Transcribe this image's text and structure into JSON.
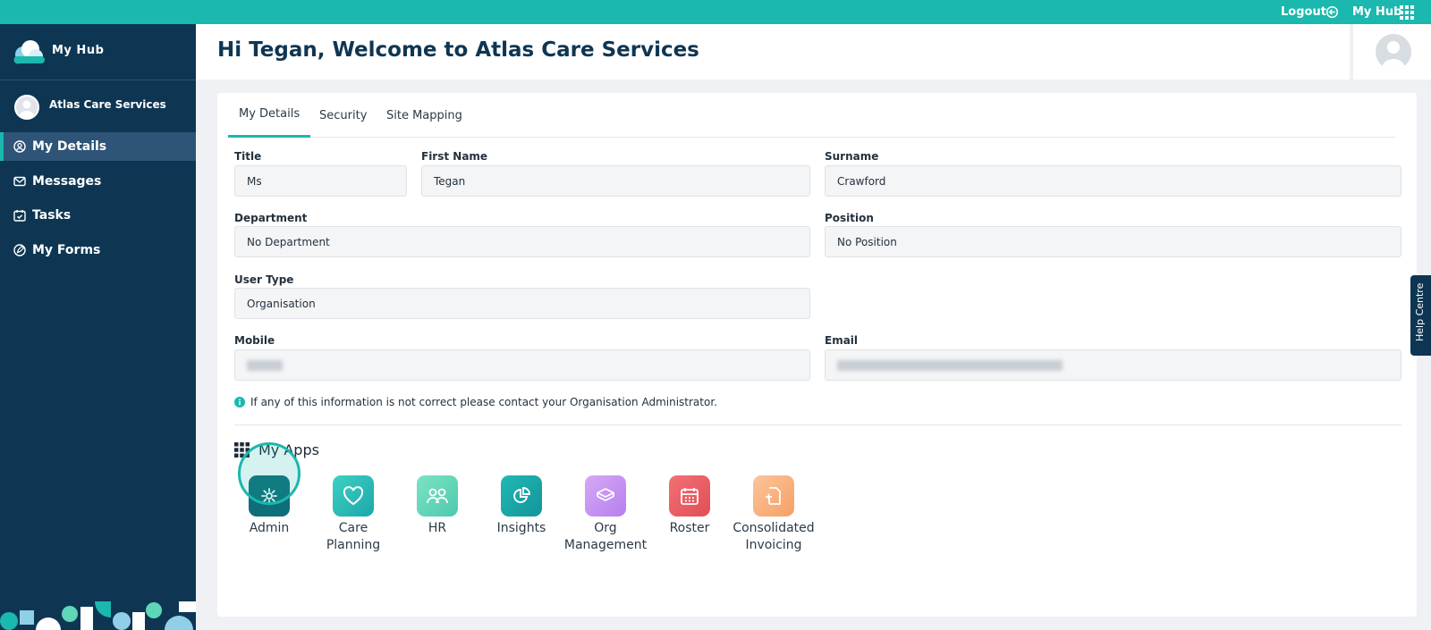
{
  "topbar": {
    "logout_label": "Logout",
    "hub_label": "My Hub",
    "accent_color": "#1ab8ae"
  },
  "sidebar": {
    "brand": "My Hub",
    "org_name": "Atlas Care Services",
    "items": [
      {
        "label": "My Details",
        "icon": "user-circle-icon",
        "active": true
      },
      {
        "label": "Messages",
        "icon": "envelope-icon",
        "active": false
      },
      {
        "label": "Tasks",
        "icon": "calendar-check-icon",
        "active": false
      },
      {
        "label": "My Forms",
        "icon": "form-icon",
        "active": false
      }
    ],
    "bg_color": "#0e3653"
  },
  "header": {
    "title": "Hi Tegan, Welcome to Atlas Care Services"
  },
  "tabs": [
    {
      "label": "My Details",
      "active": true
    },
    {
      "label": "Security",
      "active": false
    },
    {
      "label": "Site Mapping",
      "active": false
    }
  ],
  "form": {
    "title": {
      "label": "Title",
      "value": "Ms"
    },
    "first_name": {
      "label": "First Name",
      "value": "Tegan"
    },
    "surname": {
      "label": "Surname",
      "value": "Crawford"
    },
    "department": {
      "label": "Department",
      "value": "No Department"
    },
    "position": {
      "label": "Position",
      "value": "No Position"
    },
    "user_type": {
      "label": "User Type",
      "value": "Organisation"
    },
    "mobile": {
      "label": "Mobile"
    },
    "email": {
      "label": "Email"
    }
  },
  "info_text": "If any of this information is not correct please contact your Organisation Administrator.",
  "apps": {
    "heading": "My Apps",
    "items": [
      {
        "label_1": "Admin",
        "label_2": "",
        "icon": "gear-icon",
        "color": "#0e6f78"
      },
      {
        "label_1": "Care",
        "label_2": "Planning",
        "icon": "heart-icon",
        "color": "#2fc4b8"
      },
      {
        "label_1": "HR",
        "label_2": "",
        "icon": "people-icon",
        "color": "#5fd6b5"
      },
      {
        "label_1": "Insights",
        "label_2": "",
        "icon": "pie-chart-icon",
        "color": "#1aa8aa"
      },
      {
        "label_1": "Org",
        "label_2": "Management",
        "icon": "layers-icon",
        "color": "#c08cf0"
      },
      {
        "label_1": "Roster",
        "label_2": "",
        "icon": "calendar-icon",
        "color": "#ea5f64"
      },
      {
        "label_1": "Consolidated",
        "label_2": "Invoicing",
        "icon": "invoice-icon",
        "color": "#f9b07a"
      }
    ]
  },
  "help_centre": "Help Centre"
}
